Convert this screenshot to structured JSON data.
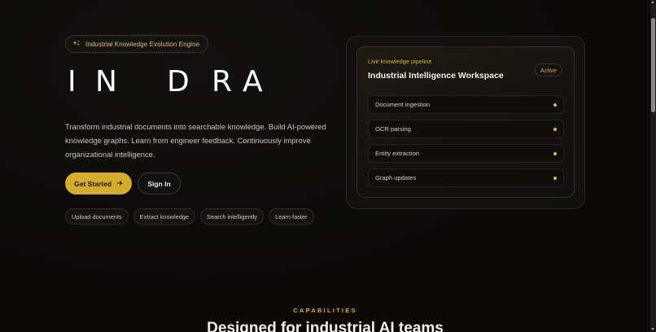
{
  "hero": {
    "badge": {
      "icon": "sparkle-icon",
      "text": "Industrial Knowledge Evolution Engine"
    },
    "brand_letters": [
      "I",
      "N",
      "",
      "D",
      "R",
      "A"
    ],
    "lead": "Transform industrial documents into searchable knowledge. Build AI-powered knowledge graphs. Learn from engineer feedback. Continuously improve organizational intelligence.",
    "primary_button": {
      "label": "Get Started",
      "icon": "arrow-right-icon"
    },
    "secondary_button": {
      "label": "Sign In"
    },
    "chips": [
      "Upload documents",
      "Extract knowledge",
      "Search intelligently",
      "Learn faster"
    ]
  },
  "workspace_card": {
    "kicker": "Live knowledge pipeline",
    "title": "Industrial Intelligence Workspace",
    "status": "Active",
    "rows": [
      {
        "label": "Document ingestion"
      },
      {
        "label": "OCR parsing"
      },
      {
        "label": "Entity extraction"
      },
      {
        "label": "Graph updates"
      }
    ]
  },
  "capabilities": {
    "kicker": "CAPABILITIES",
    "title": "Designed for industrial AI teams"
  },
  "colors": {
    "accent": "#d4ac2e",
    "background": "#0b0a09",
    "text": "#e8e4da"
  }
}
